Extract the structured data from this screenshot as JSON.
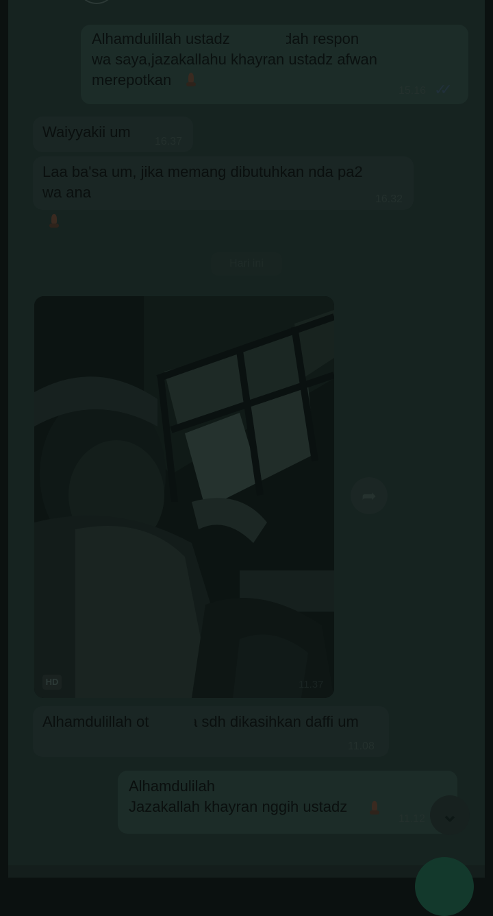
{
  "messages": [
    {
      "direction": "outgoing",
      "text": "Alhamdulillah ustadz         sudah respon\nwa saya,jazakallahu khayran ustadz afwan\nmerepotkan",
      "emoji": "pray-emoji",
      "time": "15.16",
      "status": "read"
    },
    {
      "direction": "incoming",
      "text": "Waiyyakii um",
      "time": "16.37"
    },
    {
      "direction": "incoming",
      "text": "Laa ba'sa um, jika memang dibutuhkan nda pa2\nwa ana",
      "time": "16.32"
    },
    {
      "direction": "incoming",
      "emoji": "pray-emoji"
    },
    {
      "direction": "incoming",
      "type": "photo",
      "badge": "HD",
      "time": "11.37"
    },
    {
      "direction": "incoming",
      "text": "Alhamdulillah ot       wa sdh dikasihkan daffi um",
      "time": "11.08"
    },
    {
      "direction": "outgoing",
      "text": "Alhamdulilah\nJazakallah khayran nggih ustadz",
      "emoji": "pray-emoji",
      "time": "11.12"
    }
  ],
  "date_separator": "Hari ini",
  "icons": {
    "read_ticks": "double-check-icon",
    "forward": "forward-icon",
    "scroll_down": "chevron-double-down-icon",
    "fab": "chat-fab-icon"
  },
  "colors": {
    "overlay_dim": "#0b1110",
    "chat_bg": "#162320",
    "bubble_out": "#1c2c28",
    "bubble_in": "#1a2624"
  }
}
